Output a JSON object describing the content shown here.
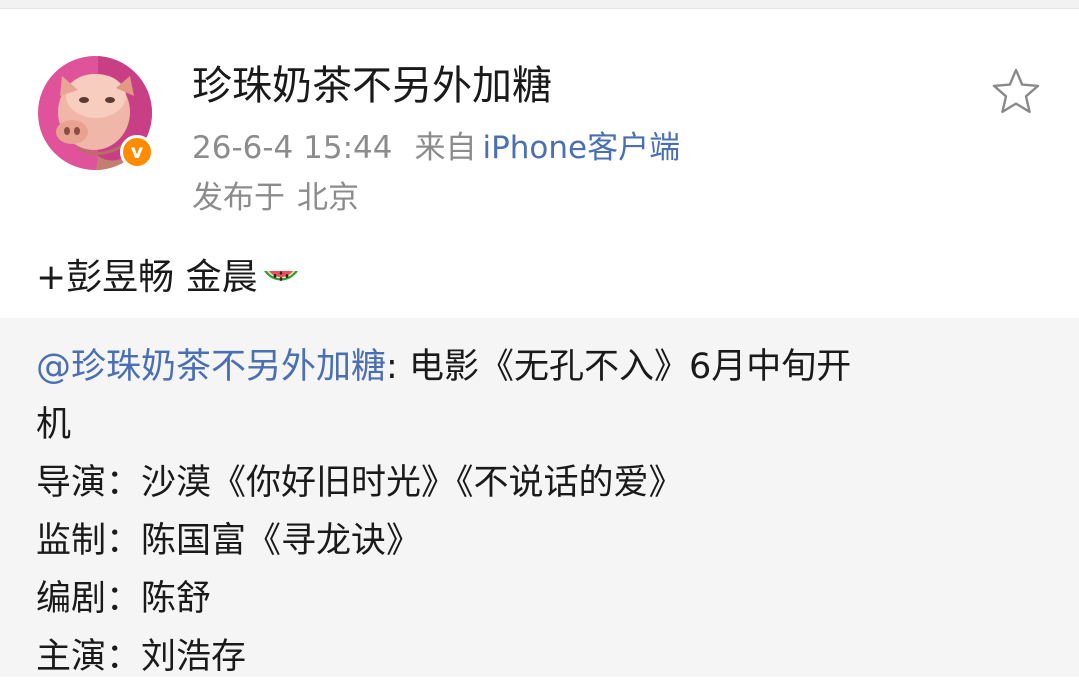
{
  "post": {
    "username": "珍珠奶茶不另外加糖",
    "time": "26-6-4 15:44",
    "from_label": "来自",
    "source": "iPhone客户端",
    "location_label": "发布于",
    "location": "北京",
    "text": "+彭昱畅 金晨",
    "emoji_icon": "watermelon-icon",
    "verified_badge": "v"
  },
  "repost": {
    "mention": "@珍珠奶茶不另外加糖",
    "colon": ": ",
    "headline_line1": "电影《无孔不入》6月中旬开",
    "headline_line2": "机",
    "details": [
      {
        "key": "导演：",
        "value": "沙漠《你好旧时光》《不说话的爱》"
      },
      {
        "key": "监制：",
        "value": "陈国富《寻龙诀》"
      },
      {
        "key": "编剧：",
        "value": "陈舒"
      },
      {
        "key": "主演：",
        "value": "刘浩存"
      }
    ]
  },
  "colors": {
    "link": "#4a6fb3",
    "meta": "#8c8c8c",
    "badge": "#ff8c00",
    "repost_background": "#f5f5f5"
  }
}
